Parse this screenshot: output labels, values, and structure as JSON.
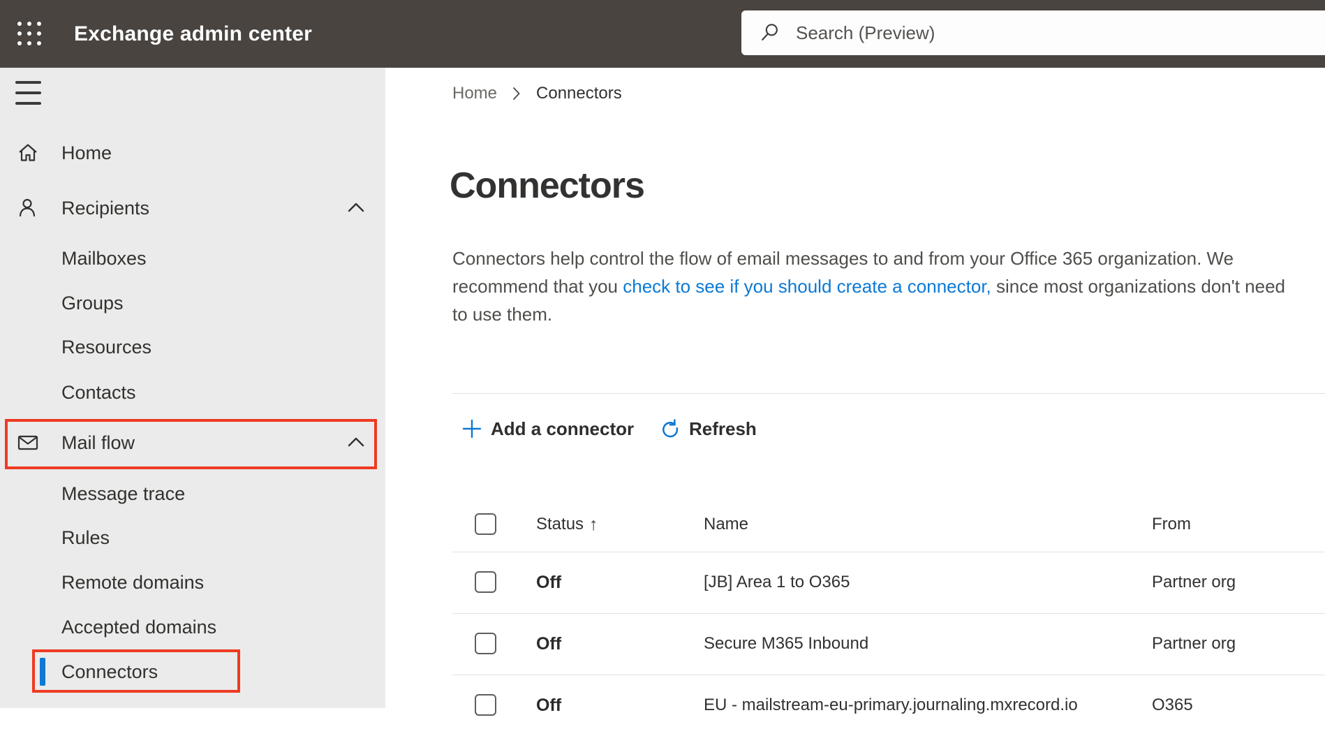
{
  "topbar": {
    "app_title": "Exchange admin center",
    "search_placeholder": "Search (Preview)"
  },
  "sidebar": {
    "items": [
      {
        "label": "Home"
      },
      {
        "label": "Recipients"
      },
      {
        "label": "Mailboxes"
      },
      {
        "label": "Groups"
      },
      {
        "label": "Resources"
      },
      {
        "label": "Contacts"
      },
      {
        "label": "Mail flow"
      },
      {
        "label": "Message trace"
      },
      {
        "label": "Rules"
      },
      {
        "label": "Remote domains"
      },
      {
        "label": "Accepted domains"
      },
      {
        "label": "Connectors"
      }
    ]
  },
  "breadcrumb": {
    "items": [
      "Home",
      "Connectors"
    ]
  },
  "page": {
    "title": "Connectors",
    "intro_before_link": "Connectors help control the flow of email messages to and from your Office 365 organization. We recommend that you ",
    "intro_link": "check to see if you should create a connector,",
    "intro_after_link": " since most organizations don't need to use them."
  },
  "toolbar": {
    "add_connector": "Add a connector",
    "refresh": "Refresh"
  },
  "table": {
    "columns": {
      "status": "Status",
      "name": "Name",
      "from": "From"
    },
    "sort_arrow": "↑",
    "rows": [
      {
        "status": "Off",
        "name": "[JB] Area 1 to O365",
        "from": "Partner org"
      },
      {
        "status": "Off",
        "name": "Secure M365 Inbound",
        "from": "Partner org"
      },
      {
        "status": "Off",
        "name": "EU - mailstream-eu-primary.journaling.mxrecord.io",
        "from": "O365"
      }
    ]
  },
  "annotations": {
    "highlighted_items": [
      "Mail flow",
      "Connectors"
    ],
    "highlight_color": "#ee3b23"
  },
  "colors": {
    "topbar_bg": "#494440",
    "sidebar_bg": "#ebebeb",
    "accent_blue": "#0b79d4",
    "selected_indicator": "#0f7ad3",
    "annotation_red": "#ee3b23"
  }
}
